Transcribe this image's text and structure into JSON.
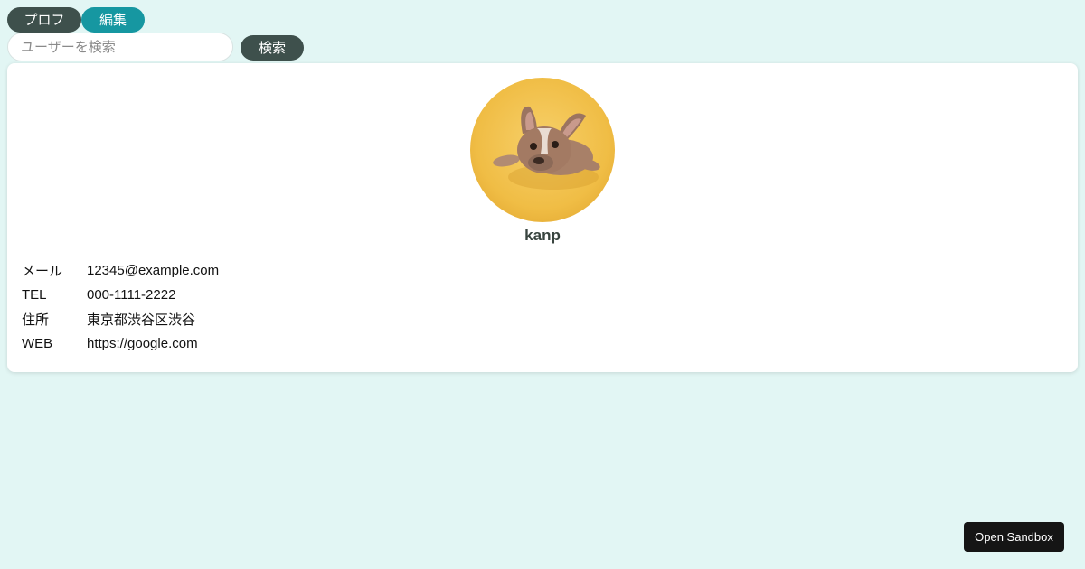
{
  "nav": {
    "tab_profile": "プロフ",
    "tab_edit": "編集"
  },
  "search": {
    "placeholder": "ユーザーを検索",
    "button_label": "検索"
  },
  "profile": {
    "avatar_icon": "dog-photo-avatar",
    "name": "kanp",
    "fields": [
      {
        "label": "メール",
        "value": "12345@example.com"
      },
      {
        "label": "TEL",
        "value": "000-1111-2222"
      },
      {
        "label": "住所",
        "value": "東京都渋谷区渋谷"
      },
      {
        "label": "WEB",
        "value": "https://google.com"
      }
    ]
  },
  "footer": {
    "sandbox_label": "Open Sandbox"
  },
  "colors": {
    "background": "#e2f6f4",
    "pill_dark": "#3e504c",
    "pill_teal": "#1697a1",
    "avatar_bg": "#f2c24d",
    "sandbox_bg": "#151515"
  }
}
